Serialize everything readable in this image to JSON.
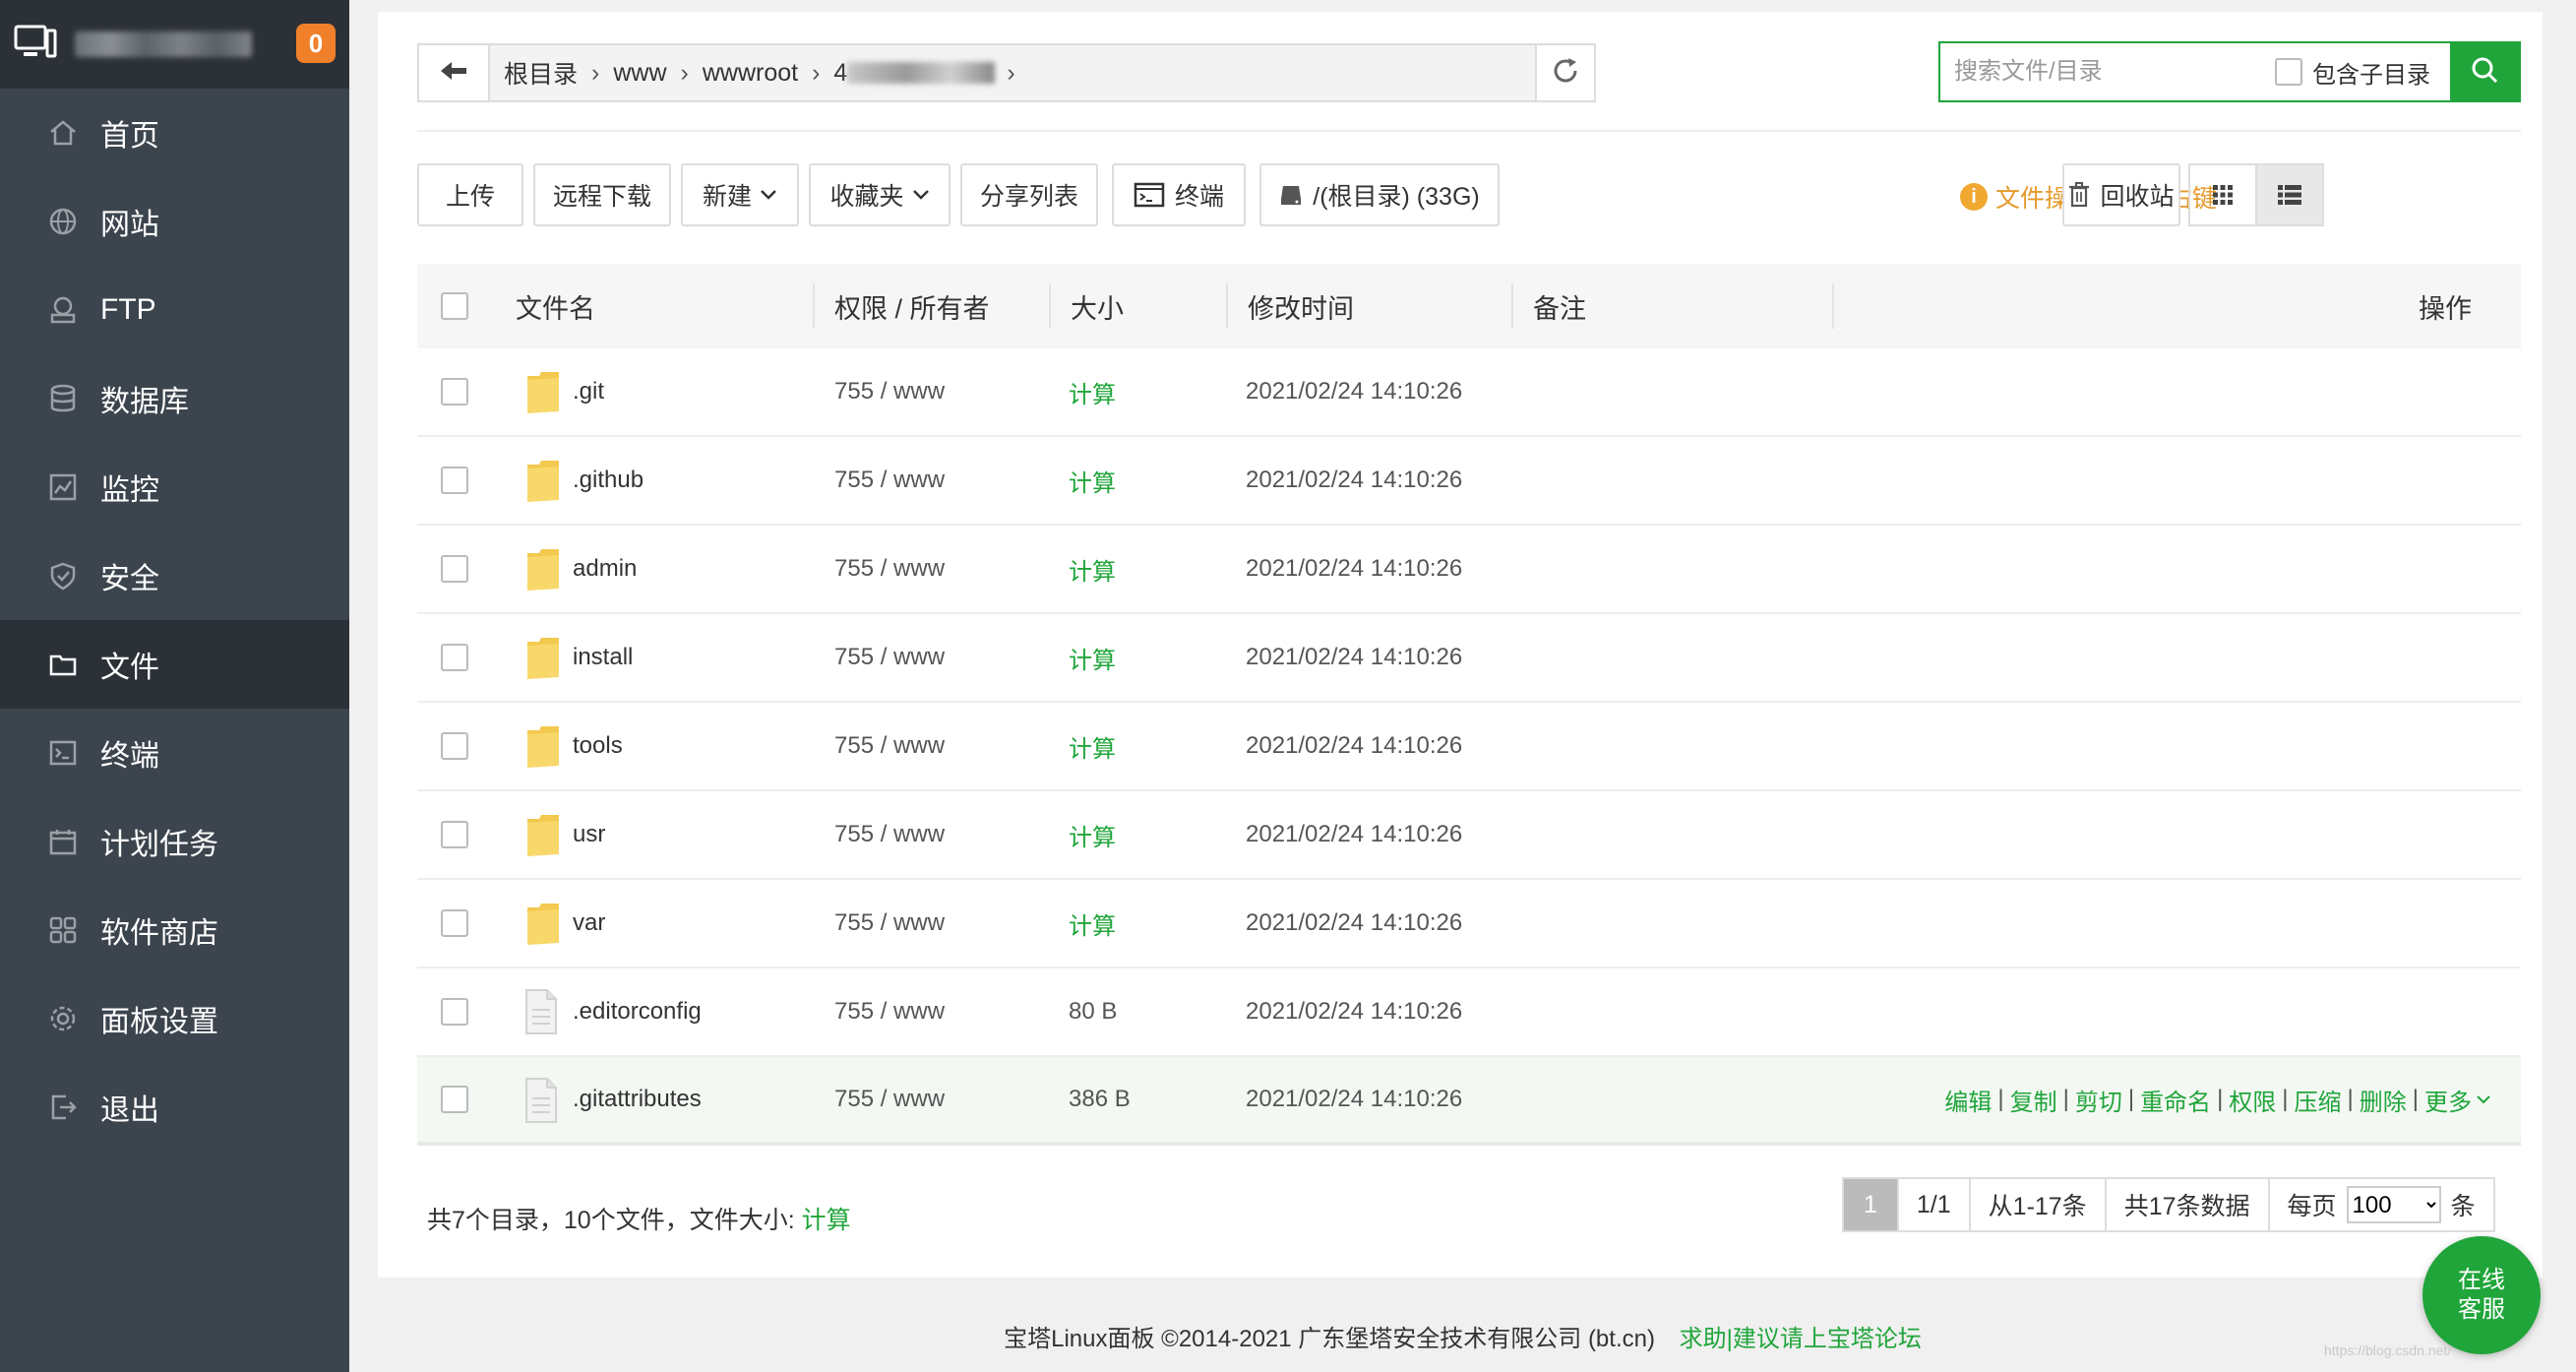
{
  "sidebar": {
    "notification_count": "0",
    "items": [
      {
        "label": "首页",
        "icon": "home-icon"
      },
      {
        "label": "网站",
        "icon": "globe-icon"
      },
      {
        "label": "FTP",
        "icon": "ftp-icon"
      },
      {
        "label": "数据库",
        "icon": "database-icon"
      },
      {
        "label": "监控",
        "icon": "monitor-icon"
      },
      {
        "label": "安全",
        "icon": "shield-icon"
      },
      {
        "label": "文件",
        "icon": "folder-icon",
        "active": true
      },
      {
        "label": "终端",
        "icon": "terminal-icon"
      },
      {
        "label": "计划任务",
        "icon": "calendar-icon"
      },
      {
        "label": "软件商店",
        "icon": "apps-icon"
      },
      {
        "label": "面板设置",
        "icon": "gear-icon"
      },
      {
        "label": "退出",
        "icon": "logout-icon"
      }
    ]
  },
  "breadcrumb": {
    "segments": [
      "根目录",
      "www",
      "wwwroot",
      "4"
    ]
  },
  "search": {
    "placeholder": "搜索文件/目录",
    "include_sub_label": "包含子目录"
  },
  "toolbar": {
    "upload": "上传",
    "remote_download": "远程下载",
    "new": "新建",
    "favorites": "收藏夹",
    "share_list": "分享列表",
    "terminal": "终端",
    "disk": "/(根目录) (33G)",
    "tip": "文件操作可使用右键",
    "recycle": "回收站"
  },
  "table": {
    "headers": {
      "name": "文件名",
      "perm": "权限 / 所有者",
      "size": "大小",
      "mtime": "修改时间",
      "note": "备注",
      "ops": "操作"
    },
    "rows": [
      {
        "name": ".git",
        "type": "folder",
        "perm": "755 / www",
        "size": "计算",
        "mtime": "2021/02/24 14:10:26"
      },
      {
        "name": ".github",
        "type": "folder",
        "perm": "755 / www",
        "size": "计算",
        "mtime": "2021/02/24 14:10:26"
      },
      {
        "name": "admin",
        "type": "folder",
        "perm": "755 / www",
        "size": "计算",
        "mtime": "2021/02/24 14:10:26"
      },
      {
        "name": "install",
        "type": "folder",
        "perm": "755 / www",
        "size": "计算",
        "mtime": "2021/02/24 14:10:26"
      },
      {
        "name": "tools",
        "type": "folder",
        "perm": "755 / www",
        "size": "计算",
        "mtime": "2021/02/24 14:10:26"
      },
      {
        "name": "usr",
        "type": "folder",
        "perm": "755 / www",
        "size": "计算",
        "mtime": "2021/02/24 14:10:26"
      },
      {
        "name": "var",
        "type": "folder",
        "perm": "755 / www",
        "size": "计算",
        "mtime": "2021/02/24 14:10:26"
      },
      {
        "name": ".editorconfig",
        "type": "file",
        "perm": "755 / www",
        "size": "80 B",
        "mtime": "2021/02/24 14:10:26"
      },
      {
        "name": ".gitattributes",
        "type": "file",
        "perm": "755 / www",
        "size": "386 B",
        "mtime": "2021/02/24 14:10:26",
        "hover": true
      }
    ],
    "row_actions": [
      "编辑",
      "复制",
      "剪切",
      "重命名",
      "权限",
      "压缩",
      "删除",
      "更多"
    ]
  },
  "summary": {
    "text": "共7个目录，10个文件，文件大小:",
    "calc_link": "计算"
  },
  "pagination": {
    "current": "1",
    "pages": "1/1",
    "range": "从1-17条",
    "total": "共17条数据",
    "per_page_label": "每页",
    "per_page_value": "100",
    "per_page_suffix": "条"
  },
  "footer": {
    "copyright": "宝塔Linux面板 ©2014-2021 广东堡塔安全技术有限公司 (bt.cn)",
    "help_link": "求助|建议请上宝塔论坛"
  },
  "online_service": {
    "line1": "在线",
    "line2": "客服"
  },
  "watermark": "https://blog.csdn.net/",
  "colors": {
    "sidebar_bg": "#3c444d",
    "sidebar_active": "#2c3138",
    "accent_green": "#20a53a",
    "badge_orange": "#f0812a",
    "tip_orange": "#e69a2d"
  }
}
